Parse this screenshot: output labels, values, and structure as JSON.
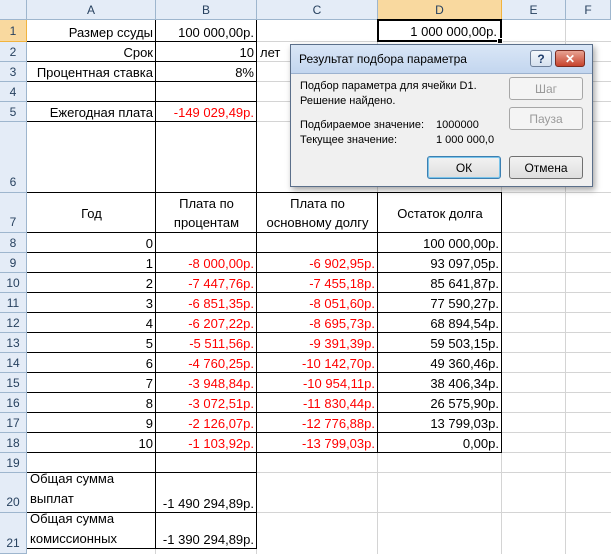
{
  "columns": [
    "A",
    "B",
    "C",
    "D",
    "E",
    "F"
  ],
  "rows": [
    "1",
    "2",
    "3",
    "4",
    "5",
    "6",
    "7",
    "8",
    "9",
    "10",
    "11",
    "12",
    "13",
    "14",
    "15",
    "16",
    "17",
    "18",
    "19",
    "20",
    "21"
  ],
  "params": {
    "loan_label": "Размер ссуды",
    "loan_value": "100 000,00р.",
    "term_label": "Срок",
    "term_value": "10",
    "term_unit": "лет",
    "rate_label": "Процентная ставка",
    "rate_value": "8%",
    "payment_label": "Ежегодная плата",
    "payment_value": "-149 029,49р.",
    "d1_value": "1 000 000,00р."
  },
  "table": {
    "col_year": "Год",
    "col_interest_1": "Плата по",
    "col_interest_2": "процентам",
    "col_principal_1": "Плата по",
    "col_principal_2": "основному долгу",
    "col_balance": "Остаток долга",
    "rows": [
      {
        "year": "0",
        "interest": "",
        "principal": "",
        "balance": "100 000,00р."
      },
      {
        "year": "1",
        "interest": "-8 000,00р.",
        "principal": "-6 902,95р.",
        "balance": "93 097,05р."
      },
      {
        "year": "2",
        "interest": "-7 447,76р.",
        "principal": "-7 455,18р.",
        "balance": "85 641,87р."
      },
      {
        "year": "3",
        "interest": "-6 851,35р.",
        "principal": "-8 051,60р.",
        "balance": "77 590,27р."
      },
      {
        "year": "4",
        "interest": "-6 207,22р.",
        "principal": "-8 695,73р.",
        "balance": "68 894,54р."
      },
      {
        "year": "5",
        "interest": "-5 511,56р.",
        "principal": "-9 391,39р.",
        "balance": "59 503,15р."
      },
      {
        "year": "6",
        "interest": "-4 760,25р.",
        "principal": "-10 142,70р.",
        "balance": "49 360,46р."
      },
      {
        "year": "7",
        "interest": "-3 948,84р.",
        "principal": "-10 954,11р.",
        "balance": "38 406,34р."
      },
      {
        "year": "8",
        "interest": "-3 072,51р.",
        "principal": "-11 830,44р.",
        "balance": "26 575,90р."
      },
      {
        "year": "9",
        "interest": "-2 126,07р.",
        "principal": "-12 776,88р.",
        "balance": "13 799,03р."
      },
      {
        "year": "10",
        "interest": "-1 103,92р.",
        "principal": "-13 799,03р.",
        "balance": "0,00р."
      }
    ]
  },
  "totals": {
    "payments_label_1": "Общая сумма",
    "payments_label_2": "выплат",
    "payments_value": "-1 490 294,89р.",
    "commission_label_1": "Общая сумма",
    "commission_label_2": "комиссионных",
    "commission_value": "-1 390 294,89р."
  },
  "dialog": {
    "title": "Результат подбора параметра",
    "help": "?",
    "close": "✕",
    "line1": "Подбор параметра для ячейки D1.",
    "line2": "Решение найдено.",
    "target_label": "Подбираемое значение:",
    "target_value": "1000000",
    "current_label": "Текущее значение:",
    "current_value": "1 000 000,0",
    "step_button": "Шаг",
    "pause_button": "Пауза",
    "ok_button": "ОК",
    "cancel_button": "Отмена"
  },
  "colors": {
    "negative": "#ff0000",
    "header_bg": "#e4ecf7",
    "selected_header_bg": "#f9d99f"
  }
}
